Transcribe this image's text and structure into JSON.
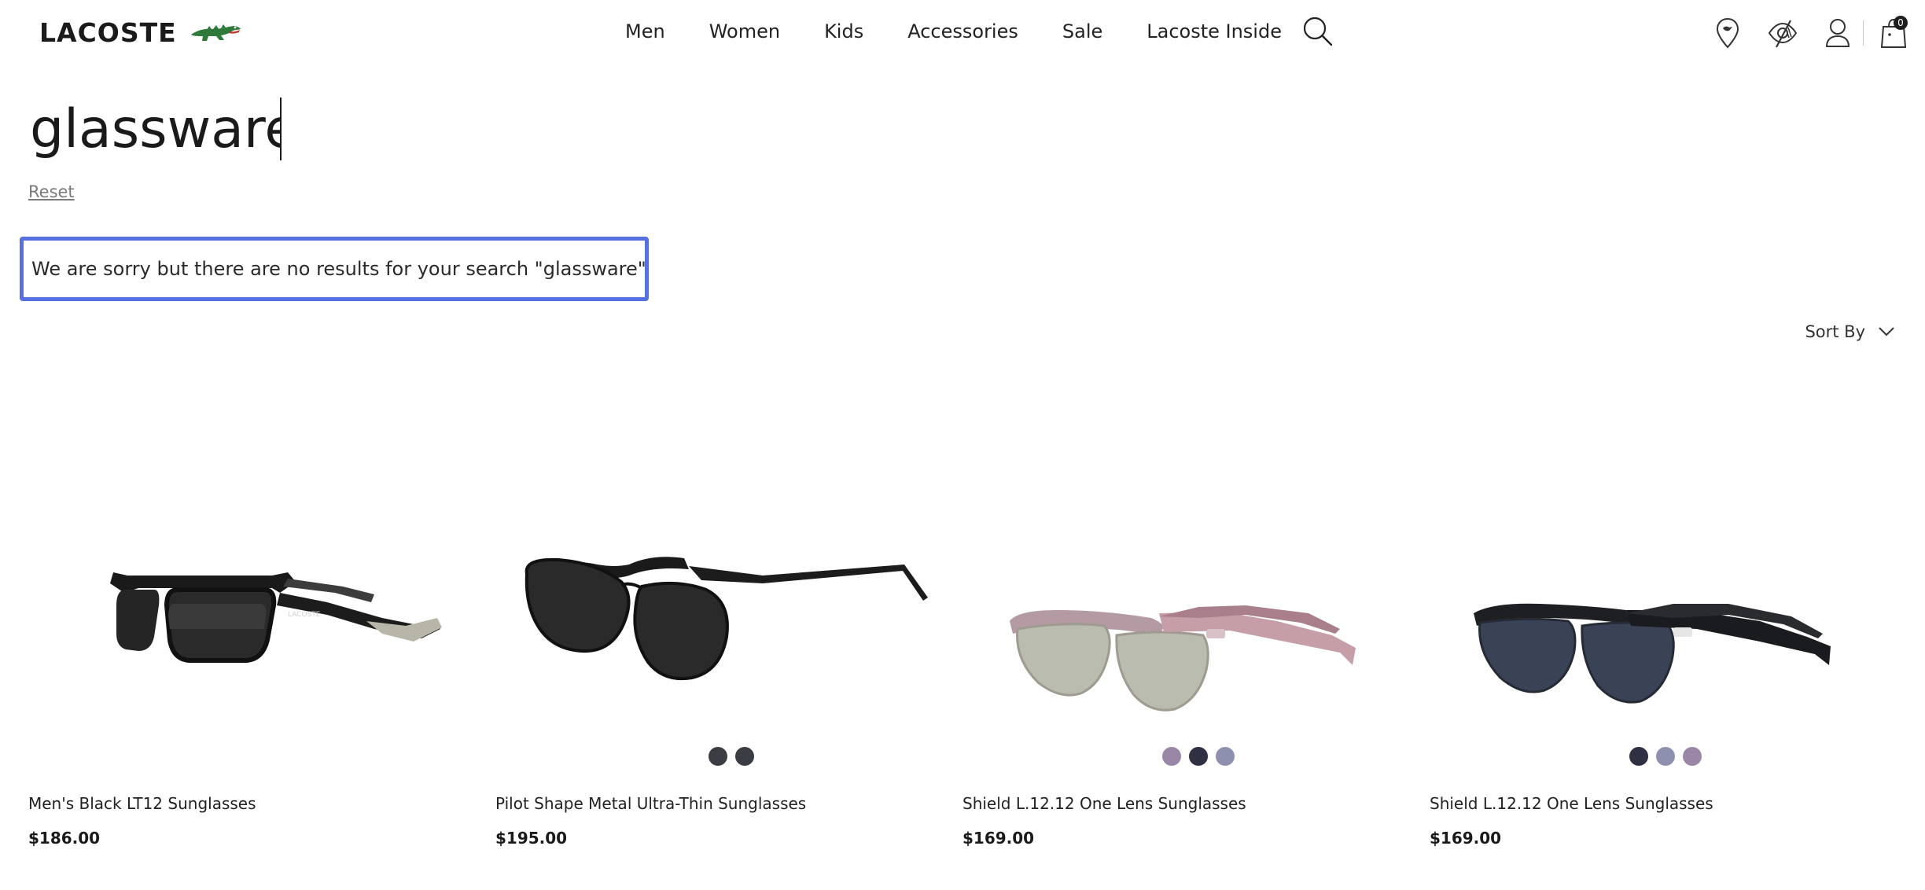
{
  "header": {
    "brand": "LACOSTE",
    "nav": [
      {
        "label": "Men"
      },
      {
        "label": "Women"
      },
      {
        "label": "Kids"
      },
      {
        "label": "Accessories"
      },
      {
        "label": "Sale"
      },
      {
        "label": "Lacoste Inside"
      }
    ],
    "icons": [
      "search-icon",
      "store-locator-icon",
      "accessibility-icon",
      "account-icon",
      "cart-icon"
    ],
    "cart_count": "0"
  },
  "search": {
    "query": "glassware",
    "reset_label": "Reset",
    "no_results_message": "We are sorry but there are no results for your search \"glassware\""
  },
  "sort": {
    "label": "Sort By"
  },
  "products": [
    {
      "name": "Men's Black LT12 Sunglasses",
      "price": "$186.00",
      "swatches": []
    },
    {
      "name": "Pilot Shape Metal Ultra-Thin Sunglasses",
      "price": "$195.00",
      "swatches": [
        "#3a3d44",
        "#3a3d44"
      ]
    },
    {
      "name": "Shield L.12.12 One Lens Sunglasses",
      "price": "$169.00",
      "swatches": [
        "#9a86a6",
        "#2e3142",
        "#8e90b0"
      ]
    },
    {
      "name": "Shield L.12.12 One Lens Sunglasses",
      "price": "$169.00",
      "swatches": [
        "#2e3142",
        "#8e90b0",
        "#9a86a6"
      ]
    }
  ],
  "colors": {
    "highlight_border": "#5670e0",
    "text": "#1e1e1e",
    "brand_green": "#2f7a3a"
  }
}
